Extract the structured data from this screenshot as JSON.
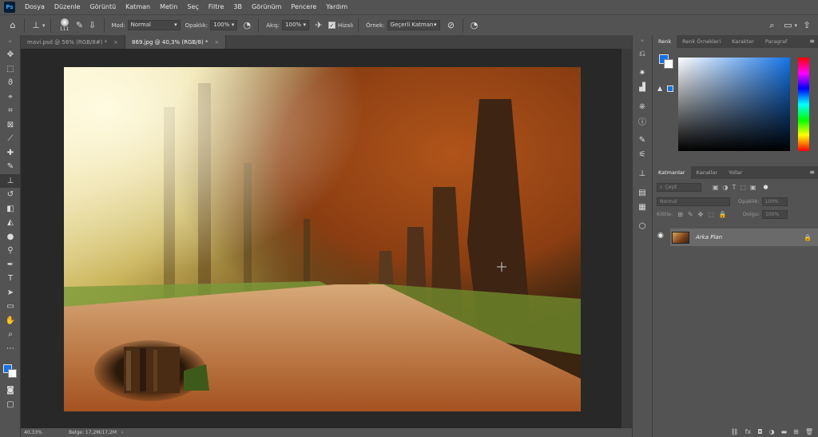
{
  "app": {
    "logo": "Ps"
  },
  "menu": [
    "Dosya",
    "Düzenle",
    "Görüntü",
    "Katman",
    "Metin",
    "Seç",
    "Filtre",
    "3B",
    "Görünüm",
    "Pencere",
    "Yardım"
  ],
  "options": {
    "brush_size": "111",
    "mode_label": "Mod:",
    "mode_value": "Normal",
    "opacity_label": "Opaklık:",
    "opacity_value": "100%",
    "flow_label": "Akış:",
    "flow_value": "100%",
    "aligned_label": "Hizalı",
    "aligned_checked": true,
    "sample_label": "Örnek:",
    "sample_value": "Geçerli Katman"
  },
  "documents": [
    {
      "title": "mavi.psd @ 56% (RGB/8#) *",
      "active": false
    },
    {
      "title": "869.jpg @ 40,3% (RGB/8) *",
      "active": true
    }
  ],
  "status": {
    "zoom": "40,33%",
    "doc_size": "Belge: 17,2M/17,2M"
  },
  "color_panel": {
    "tabs": [
      "Renk",
      "Renk Örnekleri",
      "Karakter",
      "Paragraf"
    ],
    "active_tab": "Renk",
    "foreground": "#1473e6",
    "background": "#ffffff"
  },
  "layers_panel": {
    "tabs": [
      "Katmanlar",
      "Kanallar",
      "Yollar"
    ],
    "active_tab": "Katmanlar",
    "filter_placeholder": "Çeşit",
    "blend_mode": "Normal",
    "opacity_label": "Opaklık:",
    "opacity_value": "100%",
    "lock_label": "Kilitle:",
    "fill_label": "Dolgu:",
    "fill_value": "100%",
    "layers": [
      {
        "name": "Arka Plan",
        "visible": true,
        "locked": true
      }
    ]
  }
}
